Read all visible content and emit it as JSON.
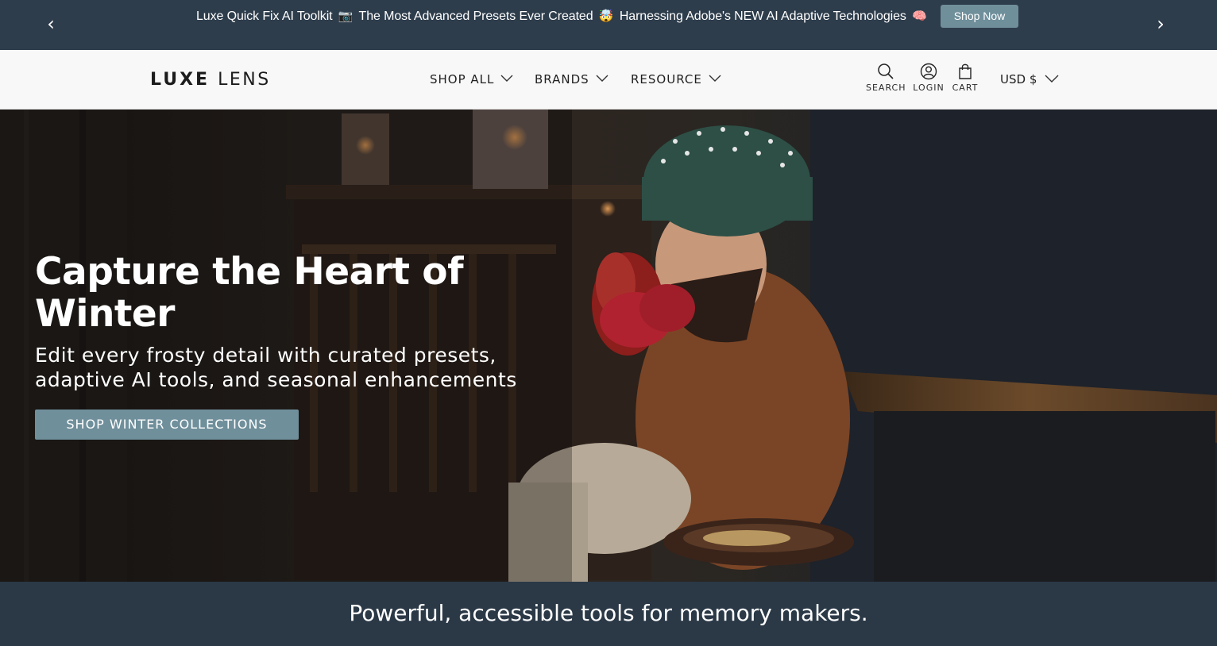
{
  "announcement": {
    "part1": "Luxe Quick Fix AI Toolkit",
    "emoji1": "📷",
    "part2": "The Most Advanced Presets Ever Created",
    "emoji2": "🤯",
    "part3": "Harnessing Adobe's NEW AI Adaptive Technologies",
    "emoji3": "🧠",
    "button": "Shop Now",
    "prev_icon": "‹",
    "next_icon": "›"
  },
  "header": {
    "logo_bold": "LUXE",
    "logo_light": "LENS",
    "nav": [
      "SHOP ALL",
      "BRANDS",
      "RESOURCE"
    ],
    "utilities": {
      "search": "SEARCH",
      "login": "LOGIN",
      "cart": "CART"
    },
    "currency": "USD $"
  },
  "hero": {
    "title": "Capture the Heart of Winter",
    "subtitle_line1": "Edit every frosty detail with curated presets,",
    "subtitle_line2": "adaptive AI tools, and seasonal enhancements",
    "cta": "SHOP WINTER COLLECTIONS"
  },
  "band": {
    "text": "Powerful, accessible tools for memory makers."
  },
  "colors": {
    "announcement_bg": "#2e3d4c",
    "accent_button": "#6f8f9b",
    "header_bg": "#f8f8f8",
    "band_bg": "#2b3947"
  }
}
